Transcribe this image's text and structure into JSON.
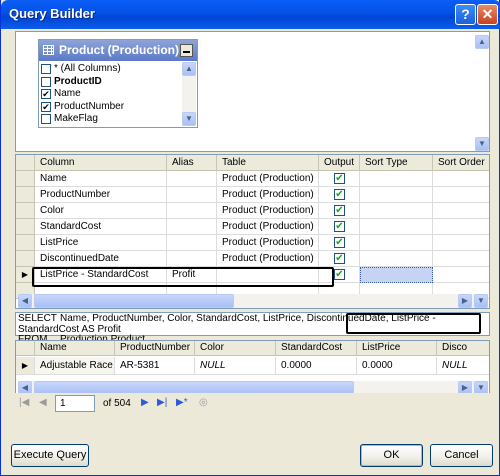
{
  "window": {
    "title": "Query Builder",
    "help_glyph": "?",
    "close_glyph": "✕"
  },
  "diagram": {
    "table_title": "Product (Production)",
    "fields": [
      {
        "label": "* (All Columns)",
        "checked": false,
        "bold": false
      },
      {
        "label": "ProductID",
        "checked": false,
        "bold": true
      },
      {
        "label": "Name",
        "checked": true,
        "bold": false
      },
      {
        "label": "ProductNumber",
        "checked": true,
        "bold": false
      },
      {
        "label": "MakeFlag",
        "checked": false,
        "bold": false
      }
    ]
  },
  "grid": {
    "headers": [
      "Column",
      "Alias",
      "Table",
      "Output",
      "Sort Type",
      "Sort Order"
    ],
    "rows": [
      {
        "column": "Name",
        "alias": "",
        "table": "Product (Production)",
        "output": true
      },
      {
        "column": "ProductNumber",
        "alias": "",
        "table": "Product (Production)",
        "output": true
      },
      {
        "column": "Color",
        "alias": "",
        "table": "Product (Production)",
        "output": true
      },
      {
        "column": "StandardCost",
        "alias": "",
        "table": "Product (Production)",
        "output": true
      },
      {
        "column": "ListPrice",
        "alias": "",
        "table": "Product (Production)",
        "output": true
      },
      {
        "column": "DiscontinuedDate",
        "alias": "",
        "table": "Product (Production)",
        "output": true
      },
      {
        "column": "ListPrice - StandardCost",
        "alias": "Profit",
        "table": "",
        "output": true
      }
    ]
  },
  "sql": {
    "select_kw": "SELECT",
    "select_text": "Name, ProductNumber, Color, StandardCost, ListPrice, DiscontinuedDate, ListPrice - StandardCost AS Profit",
    "from_kw": "FROM",
    "from_text": "Production.Product"
  },
  "results": {
    "headers": [
      "Name",
      "ProductNumber",
      "Color",
      "StandardCost",
      "ListPrice",
      "Disco"
    ],
    "row": [
      "Adjustable Race",
      "AR-5381",
      "NULL",
      "0.0000",
      "0.0000",
      "NULL"
    ]
  },
  "nav": {
    "current_page": "1",
    "of_label": "of 504"
  },
  "buttons": {
    "execute": "Execute Query",
    "ok": "OK",
    "cancel": "Cancel"
  }
}
